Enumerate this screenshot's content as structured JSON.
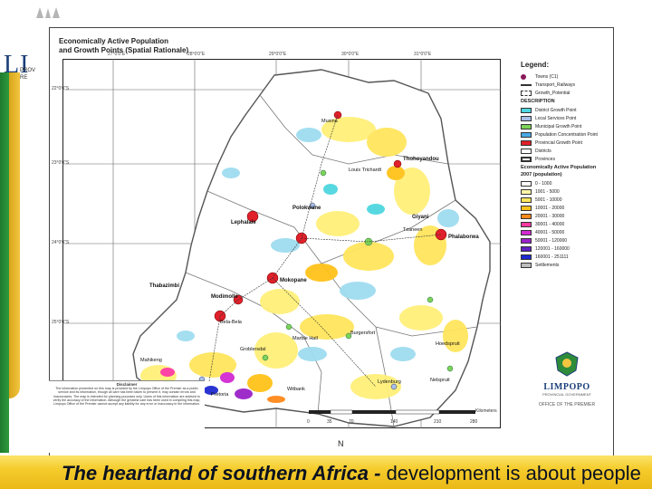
{
  "map": {
    "title_line1": "Economically Active Population",
    "title_line2": "and Growth Points (Spatial Rationale)"
  },
  "legend": {
    "title": "Legend:",
    "items": [
      {
        "label": "Towns (C1)",
        "color": "#8a1a5a"
      },
      {
        "label": "Transport_Railways",
        "color": "#333333"
      },
      {
        "label": "Growth_Potential",
        "color": "#ffffff"
      }
    ],
    "description_header": "DESCRIPTION",
    "growth_points": [
      {
        "label": "District Growth Point",
        "color": "#4fd6e0"
      },
      {
        "label": "Local Services Point",
        "color": "#a7bfe8"
      },
      {
        "label": "Municipal Growth Point",
        "color": "#7dd35a"
      },
      {
        "label": "Population Concentration Point",
        "color": "#4aa9e6"
      },
      {
        "label": "Provincial Growth Point",
        "color": "#e0202a"
      },
      {
        "label": "Districts",
        "color": "#ffffff"
      },
      {
        "label": "Provinces",
        "color": "#ffffff"
      }
    ],
    "population_header": "Economically Active Population",
    "population_subheader": "2007 (population)",
    "population_classes": [
      {
        "label": "0 - 1000",
        "color": "#ffffff"
      },
      {
        "label": "1001 - 5000",
        "color": "#fff7a8"
      },
      {
        "label": "5001 - 10000",
        "color": "#ffe55c"
      },
      {
        "label": "10001 - 20000",
        "color": "#ffc21a"
      },
      {
        "label": "20001 - 30000",
        "color": "#ff8a1a"
      },
      {
        "label": "30001 - 40000",
        "color": "#ff3aa0"
      },
      {
        "label": "40001 - 50000",
        "color": "#d22ad2"
      },
      {
        "label": "50001 - 120000",
        "color": "#9a22c8"
      },
      {
        "label": "120001 - 160000",
        "color": "#6020c0"
      },
      {
        "label": "160001 - 251111",
        "color": "#1f2ad0"
      },
      {
        "label": "Settlements",
        "color": "#bdbdbd"
      }
    ]
  },
  "grid": {
    "top": [
      "27°0'0\"E",
      "28°0'0\"E",
      "29°0'0\"E",
      "30°0'0\"E",
      "31°0'0\"E"
    ],
    "left": [
      "22°0'0\"S",
      "23°0'0\"S",
      "24°0'0\"S",
      "25°0'0\"S"
    ]
  },
  "places": [
    {
      "name": "Musina",
      "big": false
    },
    {
      "name": "Thohoyandou",
      "big": true
    },
    {
      "name": "Louis Trichardt",
      "big": false
    },
    {
      "name": "Lephalale",
      "big": true
    },
    {
      "name": "Giyani",
      "big": true
    },
    {
      "name": "Polokwane",
      "big": true
    },
    {
      "name": "Tzaneen",
      "big": false
    },
    {
      "name": "Phalaborwa",
      "big": true
    },
    {
      "name": "Mokopane",
      "big": true
    },
    {
      "name": "Modimolle",
      "big": true
    },
    {
      "name": "Bela-Bela",
      "big": false
    },
    {
      "name": "Thabazimbi",
      "big": true
    },
    {
      "name": "Groblersdal",
      "big": false
    },
    {
      "name": "Marble Hall",
      "big": false
    },
    {
      "name": "Burgersfort",
      "big": false
    },
    {
      "name": "Hoedspruit",
      "big": false
    },
    {
      "name": "Lydenburg",
      "big": false
    },
    {
      "name": "Witbank",
      "big": false
    },
    {
      "name": "Pretoria",
      "big": false
    },
    {
      "name": "Mahikeng",
      "big": false
    },
    {
      "name": "Nelspruit",
      "big": false
    }
  ],
  "scale": {
    "ticks": [
      "0",
      "35",
      "70",
      "140",
      "210",
      "280"
    ],
    "unit": "Kilometers"
  },
  "disclaimer": {
    "heading": "Disclaimer",
    "body": "The information presented on this map is provided by the Limpopo Office of the Premier as a public service and its information, though all care has been taken to present it, may contain errors and inaccuracies. The map is intended for planning purposes only. Users of this information are advised to verify the accuracy of the information. Although the greatest care has been used in compiling this map, Limpopo Office of the Premier cannot accept any liability for any error or inaccuracy in the information."
  },
  "logo": {
    "name": "LIMPOPO",
    "sub": "PROVINCIAL GOVERNMENT",
    "office": "OFFICE OF THE PREMIER"
  },
  "deco": {
    "word": "LI",
    "small1": "PROV",
    "small2": "RE"
  },
  "banner": {
    "part1": "The heartland of southern Africa - ",
    "part2": "development is about people"
  }
}
